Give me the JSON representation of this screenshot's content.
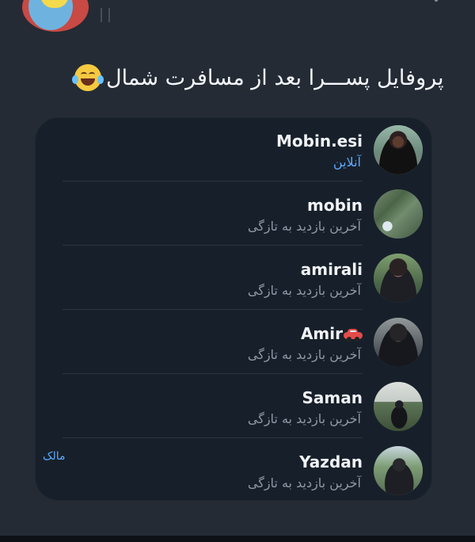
{
  "post": {
    "caption": "پروفایل پســـرا بعد از مسافرت شمال",
    "emoji": "laughing-face"
  },
  "contacts": [
    {
      "name": "Mobin.esi",
      "status": "آنلاین",
      "status_type": "online",
      "avatar_icon": "person-avatar"
    },
    {
      "name": "mobin",
      "status": "آخرین بازدید به تازگی",
      "status_type": "recent",
      "avatar_icon": "landscape-avatar"
    },
    {
      "name": "amirali",
      "status": "آخرین بازدید به تازگی",
      "status_type": "recent",
      "avatar_icon": "person-avatar"
    },
    {
      "name": "Amir",
      "status": "آخرین بازدید به تازگی",
      "status_type": "recent",
      "avatar_icon": "person-avatar",
      "emoji": "car"
    },
    {
      "name": "Saman",
      "status": "آخرین بازدید به تازگی",
      "status_type": "recent",
      "avatar_icon": "person-avatar"
    },
    {
      "name": "Yazdan",
      "status": "آخرین بازدید به تازگی",
      "status_type": "recent",
      "avatar_icon": "person-avatar",
      "role": "مالک"
    }
  ],
  "colors": {
    "background": "#242b35",
    "panel": "#17202a",
    "online": "#5ba8ff",
    "muted_text": "#8f98a5"
  }
}
